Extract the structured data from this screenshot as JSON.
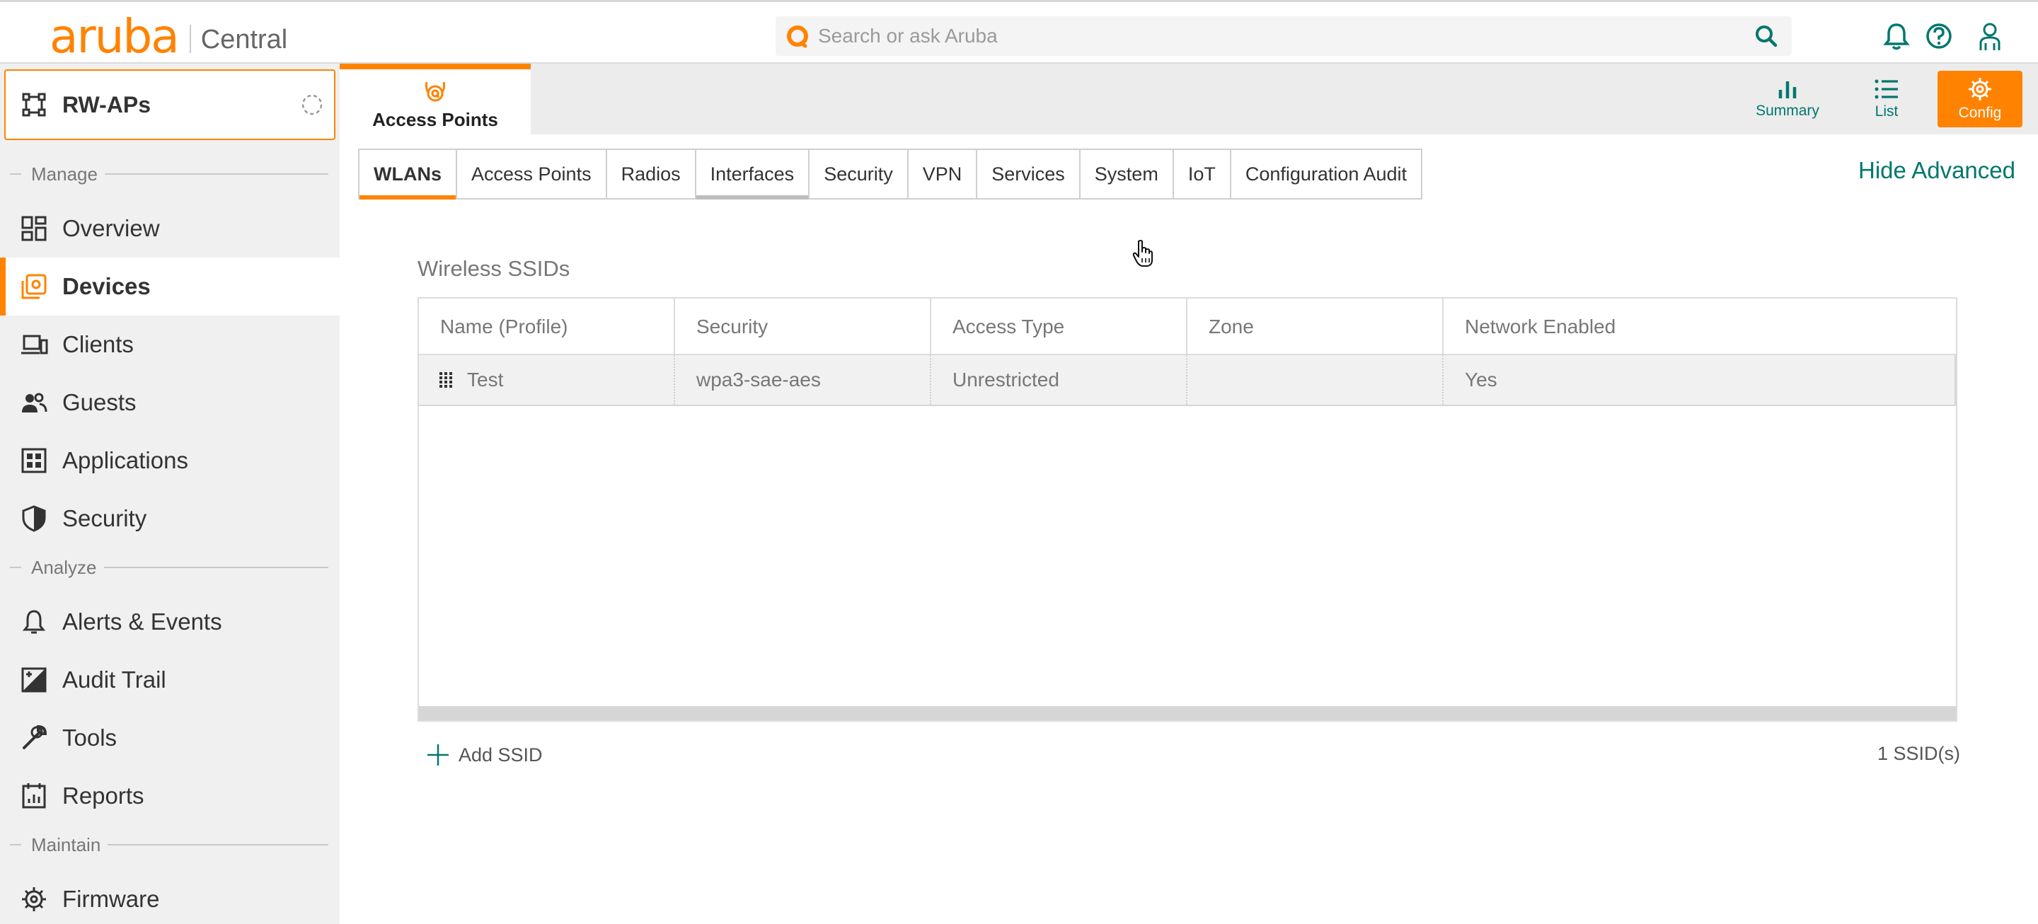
{
  "brand": {
    "logo": "aruba",
    "product": "Central",
    "accent": "#ff8300",
    "teal": "#00776d"
  },
  "search": {
    "placeholder": "Search or ask Aruba"
  },
  "topbar_icons": [
    "bell-icon",
    "help-icon",
    "user-icon"
  ],
  "group": {
    "name": "RW-APs"
  },
  "sidebar": {
    "sections": {
      "manage": "Manage",
      "analyze": "Analyze",
      "maintain": "Maintain"
    },
    "items": [
      {
        "label": "Overview",
        "icon": "overview-grid-icon"
      },
      {
        "label": "Devices",
        "icon": "devices-icon",
        "active": true
      },
      {
        "label": "Clients",
        "icon": "clients-icon"
      },
      {
        "label": "Guests",
        "icon": "guests-icon"
      },
      {
        "label": "Applications",
        "icon": "applications-icon"
      },
      {
        "label": "Security",
        "icon": "shield-icon"
      },
      {
        "label": "Alerts & Events",
        "icon": "bell-icon"
      },
      {
        "label": "Audit Trail",
        "icon": "audit-trail-icon"
      },
      {
        "label": "Tools",
        "icon": "wrench-icon"
      },
      {
        "label": "Reports",
        "icon": "reports-icon"
      },
      {
        "label": "Firmware",
        "icon": "gear-icon"
      }
    ]
  },
  "header": {
    "device_tab": "Access Points",
    "views": {
      "summary": "Summary",
      "list": "List",
      "config": "Config"
    }
  },
  "subtabs": [
    "WLANs",
    "Access Points",
    "Radios",
    "Interfaces",
    "Security",
    "VPN",
    "Services",
    "System",
    "IoT",
    "Configuration Audit"
  ],
  "hide_advanced": "Hide Advanced",
  "wlans": {
    "title": "Wireless SSIDs",
    "columns": [
      "Name (Profile)",
      "Security",
      "Access Type",
      "Zone",
      "Network Enabled"
    ],
    "rows": [
      {
        "name": "Test",
        "security": "wpa3-sae-aes",
        "access_type": "Unrestricted",
        "zone": "",
        "enabled": "Yes"
      }
    ],
    "add_label": "Add SSID",
    "count": "1 SSID(s)"
  }
}
